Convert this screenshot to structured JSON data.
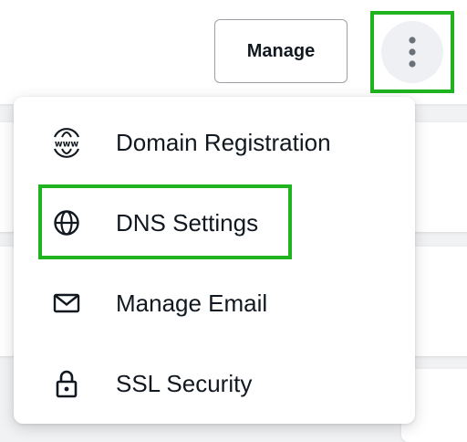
{
  "header": {
    "manage_button_label": "Manage"
  },
  "more_menu": {
    "icon": "vertical-dots-icon",
    "items": [
      {
        "label": "Domain Registration",
        "icon": "www-globe-icon"
      },
      {
        "label": "DNS Settings",
        "icon": "globe-icon"
      },
      {
        "label": "Manage Email",
        "icon": "envelope-icon"
      },
      {
        "label": "SSL Security",
        "icon": "lock-icon"
      }
    ]
  },
  "colors": {
    "highlight": "#1fb31f",
    "text": "#111820",
    "kebab_bg": "#eef0f3"
  }
}
